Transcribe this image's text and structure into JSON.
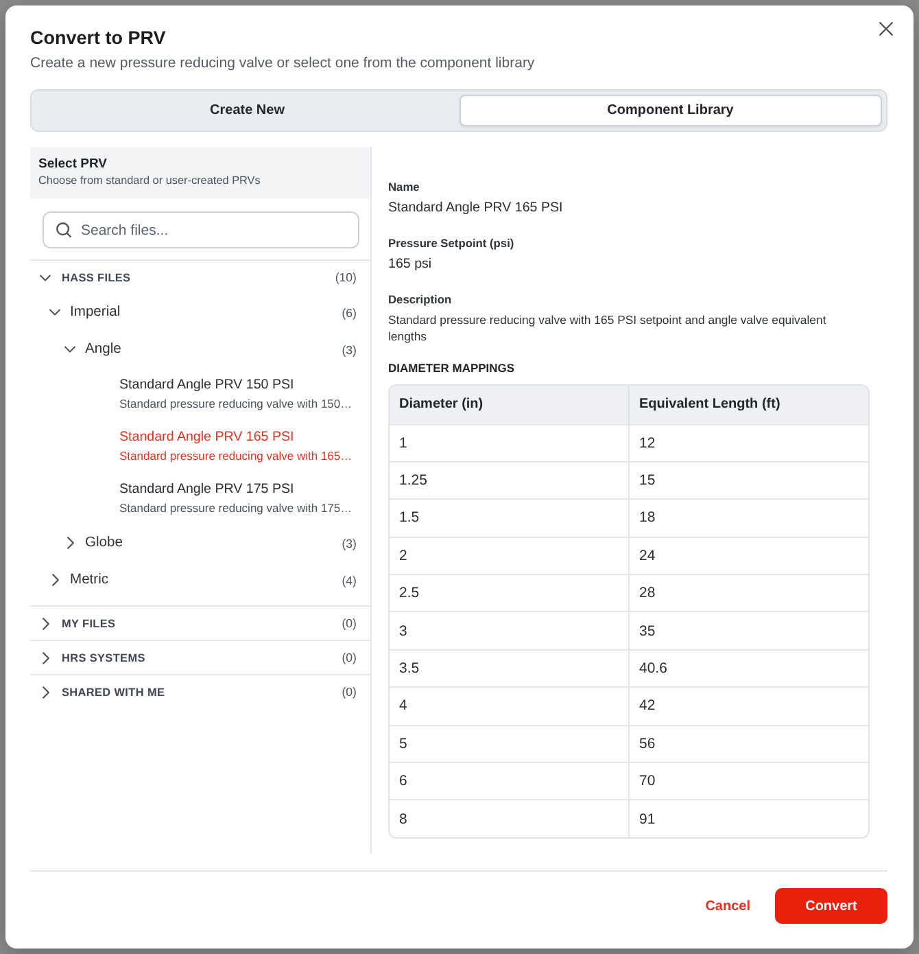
{
  "dialog": {
    "title": "Convert to PRV",
    "subtitle": "Create a new pressure reducing valve or select one from the component library"
  },
  "tabs": [
    {
      "label": "Create New",
      "selected": false
    },
    {
      "label": "Component Library",
      "selected": true
    }
  ],
  "library": {
    "title": "Select PRV",
    "subtitle": "Choose from standard or user-created PRVs",
    "search": {
      "placeholder": "Search files..."
    },
    "tree": [
      {
        "kind": "section",
        "label": "HASS FILES",
        "count": "(10)",
        "expanded": true,
        "children": [
          {
            "kind": "folder",
            "label": "Imperial",
            "count": "(6)",
            "expanded": true,
            "children": [
              {
                "kind": "folder",
                "label": "Angle",
                "count": "(3)",
                "expanded": true,
                "children": [
                  {
                    "kind": "file",
                    "name": "Standard Angle PRV 150 PSI",
                    "description": "Standard pressure reducing valve with 150…",
                    "selected": false
                  },
                  {
                    "kind": "file",
                    "name": "Standard Angle PRV 165 PSI",
                    "description": "Standard pressure reducing valve with 165…",
                    "selected": true
                  },
                  {
                    "kind": "file",
                    "name": "Standard Angle PRV 175 PSI",
                    "description": "Standard pressure reducing valve with 175…",
                    "selected": false
                  }
                ]
              },
              {
                "kind": "folder",
                "label": "Globe",
                "count": "(3)",
                "expanded": false
              }
            ]
          },
          {
            "kind": "folder",
            "label": "Metric",
            "count": "(4)",
            "expanded": false
          }
        ]
      },
      {
        "kind": "section",
        "label": "MY FILES",
        "count": "(0)",
        "expanded": false
      },
      {
        "kind": "section",
        "label": "HRS SYSTEMS",
        "count": "(0)",
        "expanded": false
      },
      {
        "kind": "section",
        "label": "SHARED WITH ME",
        "count": "(0)",
        "expanded": false
      }
    ]
  },
  "details": {
    "fields": [
      {
        "kind": "value",
        "label": "Name",
        "value": "Standard Angle PRV 165 PSI"
      },
      {
        "kind": "value",
        "label": "Pressure Setpoint (psi)",
        "value": "165 psi"
      },
      {
        "kind": "note",
        "label": "Description",
        "value": "Standard pressure reducing valve with 165 PSI setpoint and angle valve equivalent lengths"
      }
    ],
    "mappings": {
      "title": "DIAMETER MAPPINGS",
      "columns": [
        "Diameter (in)",
        "Equivalent Length (ft)"
      ],
      "rows": [
        [
          "1",
          "12"
        ],
        [
          "1.25",
          "15"
        ],
        [
          "1.5",
          "18"
        ],
        [
          "2",
          "24"
        ],
        [
          "2.5",
          "28"
        ],
        [
          "3",
          "35"
        ],
        [
          "3.5",
          "40.6"
        ],
        [
          "4",
          "42"
        ],
        [
          "5",
          "56"
        ],
        [
          "6",
          "70"
        ],
        [
          "8",
          "91"
        ]
      ]
    }
  },
  "footer": {
    "buttons": [
      {
        "kind": "secondary",
        "label": "Cancel"
      },
      {
        "kind": "primary",
        "label": "Convert"
      }
    ]
  }
}
